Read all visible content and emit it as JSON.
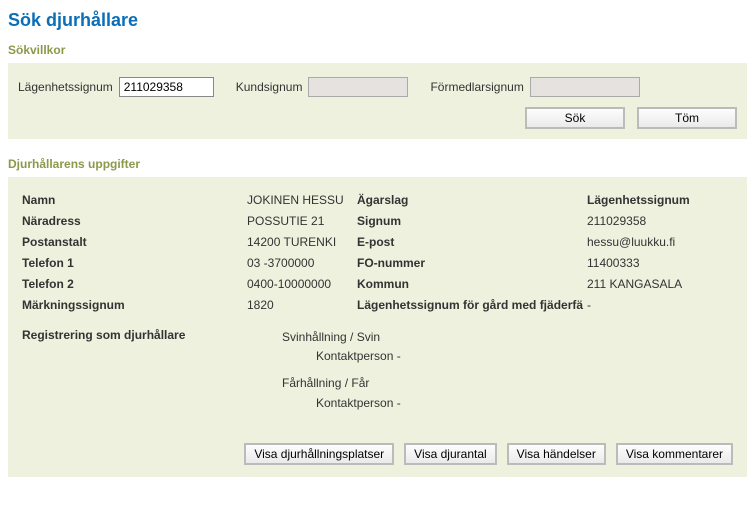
{
  "page": {
    "title": "Sök djurhållare"
  },
  "sections": {
    "criteria": "Sökvillkor",
    "details": "Djurhållarens uppgifter"
  },
  "criteria": {
    "labels": {
      "lagenhet": "Lägenhetssignum",
      "kund": "Kundsignum",
      "formedlar": "Förmedlarsignum"
    },
    "values": {
      "lagenhet": "211029358",
      "kund": "",
      "formedlar": ""
    }
  },
  "buttons": {
    "search": "Sök",
    "clear": "Töm",
    "visa_platser": "Visa djurhållningsplatser",
    "visa_djurantal": "Visa djurantal",
    "visa_handelser": "Visa händelser",
    "visa_kommentarer": "Visa kommentarer"
  },
  "details": {
    "labels": {
      "namn": "Namn",
      "naradress": "Näradress",
      "postanstalt": "Postanstalt",
      "telefon1": "Telefon 1",
      "telefon2": "Telefon 2",
      "markning": "Märkningssignum",
      "agarslag": "Ägarslag",
      "signum": "Signum",
      "epost": "E-post",
      "fonummer": "FO-nummer",
      "kommun": "Kommun",
      "fjaderfa": "Lägenhetssignum för gård med fjäderfä",
      "lagenhet": "Lägenhetssignum"
    },
    "values": {
      "namn": "JOKINEN HESSU",
      "naradress": "POSSUTIE 21",
      "postanstalt": "14200 TURENKI",
      "telefon1": "03 -3700000",
      "telefon2": "0400-10000000",
      "markning": "1820",
      "agarslag": "",
      "signum": "",
      "epost": "hessu@luukku.fi",
      "fonummer": "11400333",
      "kommun": "211 KANGASALA",
      "fjaderfa": "-",
      "lagenhet": "211029358"
    }
  },
  "registration": {
    "label": "Registrering som djurhållare",
    "entries": [
      {
        "line": "Svinhållning / Svin",
        "contact": "Kontaktperson -"
      },
      {
        "line": "Fårhållning / Får",
        "contact": "Kontaktperson -"
      }
    ]
  }
}
